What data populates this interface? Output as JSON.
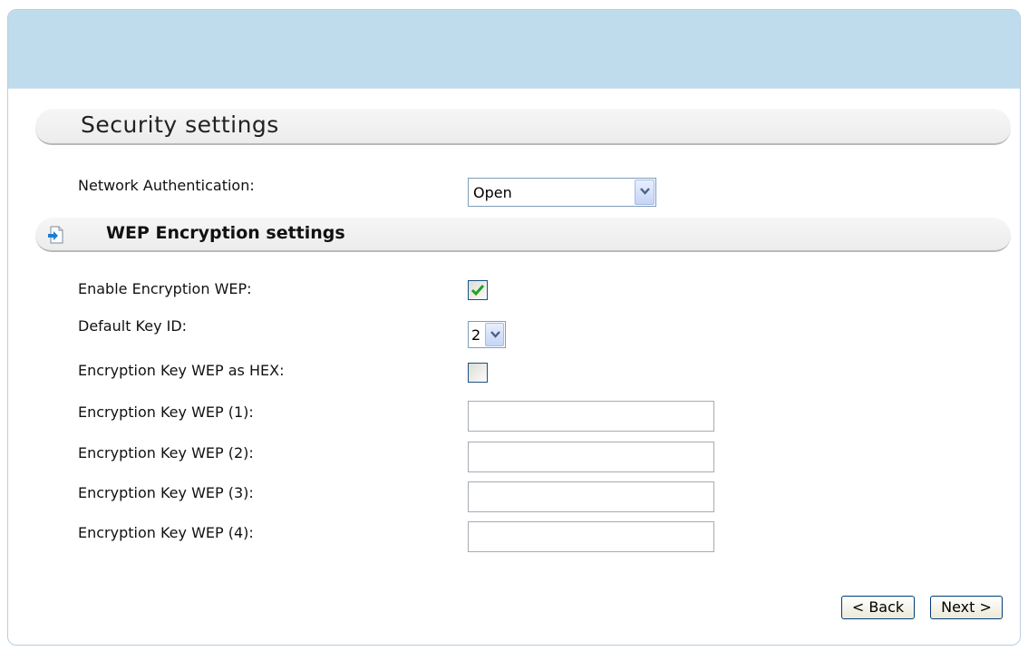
{
  "section_title": "Security settings",
  "network_auth": {
    "label": "Network Authentication:",
    "value": "Open"
  },
  "wep_section_title": "WEP Encryption settings",
  "enable_wep": {
    "label": "Enable Encryption WEP:",
    "checked": true
  },
  "default_key": {
    "label": "Default Key ID:",
    "value": "2"
  },
  "hex_key": {
    "label": "Encryption Key WEP as HEX:",
    "checked": false
  },
  "keys": [
    {
      "label": "Encryption Key WEP (1):",
      "value": ""
    },
    {
      "label": "Encryption Key WEP (2):",
      "value": ""
    },
    {
      "label": "Encryption Key WEP (3):",
      "value": ""
    },
    {
      "label": "Encryption Key WEP (4):",
      "value": ""
    }
  ],
  "buttons": {
    "back": "< Back",
    "next": "Next >"
  },
  "icons": {
    "section_icon": "document-arrow-icon",
    "dropdown_icon": "chevron-down-icon",
    "check_icon": "checkmark-icon"
  },
  "colors": {
    "header_band": "#bfdcec",
    "checkmark": "#21a121",
    "icon_arrow": "#1a7fd4"
  }
}
